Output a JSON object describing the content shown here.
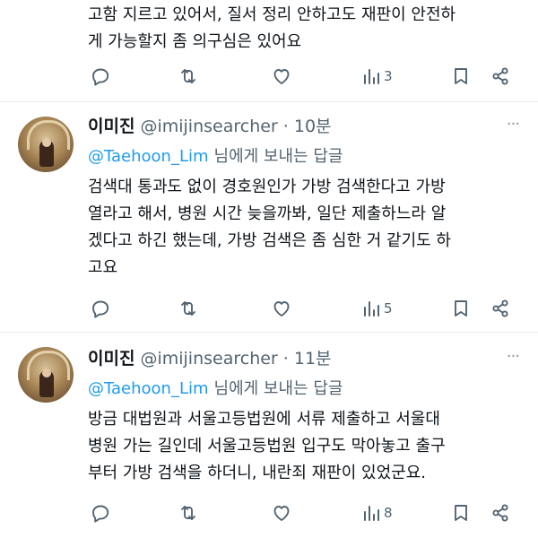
{
  "colors": {
    "accent": "#1d9bf0",
    "muted": "#536471",
    "text": "#0f1419",
    "divider": "#e6e9ec"
  },
  "top_tweet": {
    "lines": [
      "고함 지르고 있어서, 질서 정리 안하고도 재판이 안전하",
      "게 가능할지 좀 의구심은 있어요"
    ],
    "views": "3"
  },
  "tweets": [
    {
      "name": "이미진",
      "handle": "@imijinsearcher · 10분",
      "mention": "@Taehoon_Lim",
      "reply_label": "님에게 보내는 답글",
      "lines": [
        "검색대 통과도 없이 경호원인가 가방 검색한다고 가방",
        "열라고 해서, 병원 시간 늦을까봐, 일단 제출하느라 알",
        "겠다고 하긴 했는데, 가방 검색은 좀 심한 거 같기도 하",
        "고요"
      ],
      "views": "5"
    },
    {
      "name": "이미진",
      "handle": "@imijinsearcher · 11분",
      "mention": "@Taehoon_Lim",
      "reply_label": "님에게 보내는 답글",
      "lines": [
        "방금 대법원과 서울고등법원에 서류 제출하고 서울대",
        "병원 가는 길인데 서울고등법원 입구도 막아놓고 출구",
        "부터 가방 검색을 하더니, 내란죄 재판이 있었군요."
      ],
      "views": "8"
    }
  ],
  "icons": [
    "reply-icon",
    "retweet-icon",
    "like-icon",
    "views-icon",
    "bookmark-icon",
    "share-icon",
    "more-icon"
  ]
}
